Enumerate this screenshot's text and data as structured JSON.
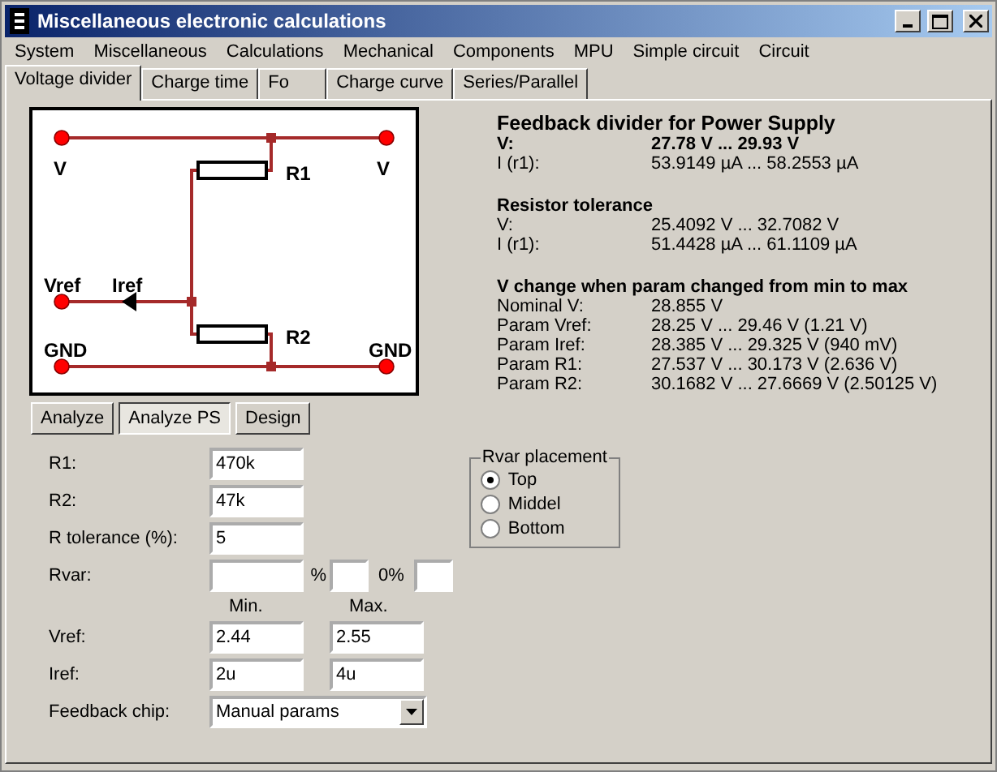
{
  "window": {
    "title": "Miscellaneous electronic calculations"
  },
  "menu": [
    "System",
    "Miscellaneous",
    "Calculations",
    "Mechanical",
    "Components",
    "MPU",
    "Simple circuit",
    "Circuit"
  ],
  "tabs": [
    {
      "label": "Voltage divider",
      "selected": true
    },
    {
      "label": "Charge time",
      "selected": false
    },
    {
      "label": "Fo",
      "selected": false
    },
    {
      "label": "Charge curve",
      "selected": false
    },
    {
      "label": "Series/Parallel",
      "selected": false
    }
  ],
  "circuit": {
    "top_left": "V",
    "top_right": "V",
    "r1": "R1",
    "r2": "R2",
    "vref": "Vref",
    "iref": "Iref",
    "gnd_left": "GND",
    "gnd_right": "GND"
  },
  "buttons": [
    {
      "label": "Analyze",
      "selected": false
    },
    {
      "label": "Analyze PS",
      "selected": true
    },
    {
      "label": "Design",
      "selected": false
    }
  ],
  "results": [
    {
      "title": "Feedback divider for Power Supply",
      "rows": [
        {
          "label": "V:",
          "value": "27.78 V ... 29.93 V",
          "bold": true
        },
        {
          "label": "I (r1):",
          "value": "53.9149 µA ... 58.2553 µA",
          "bold": false
        }
      ]
    },
    {
      "title": "Resistor tolerance",
      "rows": [
        {
          "label": "V:",
          "value": "25.4092 V ... 32.7082 V",
          "bold": false
        },
        {
          "label": "I (r1):",
          "value": "51.4428 µA ... 61.1109 µA",
          "bold": false
        }
      ]
    },
    {
      "title": "V change when param changed from min to max",
      "rows": [
        {
          "label": "Nominal V:",
          "value": "28.855 V",
          "bold": false
        },
        {
          "label": "Param Vref:",
          "value": "28.25 V ... 29.46 V (1.21 V)",
          "bold": false
        },
        {
          "label": "Param Iref:",
          "value": "28.385 V ... 29.325 V (940 mV)",
          "bold": false
        },
        {
          "label": "Param R1:",
          "value": "27.537 V ... 30.173 V (2.636 V)",
          "bold": false
        },
        {
          "label": "Param R2:",
          "value": "30.1682 V ... 27.6669 V (2.50125 V)",
          "bold": false
        }
      ]
    }
  ],
  "form": {
    "r1": {
      "label": "R1:",
      "value": "470k"
    },
    "r2": {
      "label": "R2:",
      "value": "47k"
    },
    "tolerance": {
      "label": "R tolerance (%):",
      "value": "5"
    },
    "rvar": {
      "label": "Rvar:",
      "pct_label": "%",
      "zero_label": "0%"
    },
    "min_header": "Min.",
    "max_header": "Max.",
    "vref": {
      "label": "Vref:",
      "min": "2.44",
      "max": "2.55"
    },
    "iref": {
      "label": "Iref:",
      "min": "2u",
      "max": "4u"
    },
    "chip": {
      "label": "Feedback chip:",
      "value": "Manual params"
    }
  },
  "placement": {
    "title": "Rvar placement",
    "options": [
      {
        "label": "Top",
        "selected": true
      },
      {
        "label": "Middel",
        "selected": false
      },
      {
        "label": "Bottom",
        "selected": false
      }
    ]
  }
}
